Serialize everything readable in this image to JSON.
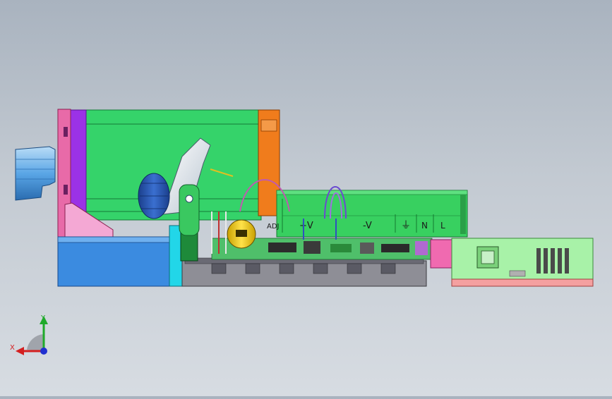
{
  "terminal_labels": {
    "adj": "ADJ",
    "plus_v": "+V",
    "minus_v": "-V",
    "ground": "⏚",
    "neutral": "N",
    "line": "L"
  },
  "triad": {
    "x_label": "X",
    "y_label": "Y",
    "colors": {
      "x": "#d42020",
      "y": "#1faa2a",
      "z": "#2030d0"
    }
  },
  "colors": {
    "housing_green": "#35d36a",
    "psu_green": "#38d060",
    "purple_panel": "#9b32e6",
    "orange_panel": "#f07c1c",
    "pink_bracket": "#e86aa8",
    "base_blue": "#3b8be0",
    "cyan_post": "#22d6e8",
    "right_board": "#a8f2a8",
    "knob_blue": "#5aa6e6"
  }
}
